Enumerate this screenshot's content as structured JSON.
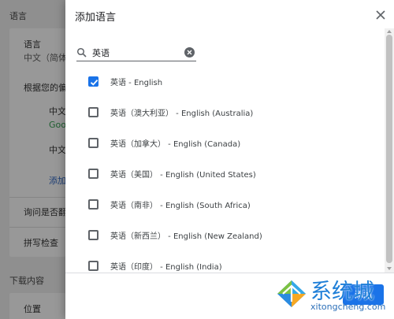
{
  "background": {
    "languages_heading": "语言",
    "language_label": "语言",
    "language_value": "中文（简体",
    "recommendation_text": "根据您的偏",
    "lang_entry_1": "中文",
    "lang_entry_1_sub": "Goo",
    "lang_entry_2": "中文",
    "add_link": "添加",
    "translate_prompt": "询问是否翻",
    "spellcheck_label": "拼写检查",
    "downloads_heading": "下载内容",
    "location_label": "位置"
  },
  "dialog": {
    "title": "添加语言",
    "close_icon": "close-icon",
    "search": {
      "value": "英语",
      "placeholder": ""
    },
    "languages": [
      {
        "label": "英语 - English",
        "checked": true
      },
      {
        "label": "英语（澳大利亚） - English (Australia)",
        "checked": false
      },
      {
        "label": "英语（加拿大） - English (Canada)",
        "checked": false
      },
      {
        "label": "英语（美国） - English (United States)",
        "checked": false
      },
      {
        "label": "英语（南非） - English (South Africa)",
        "checked": false
      },
      {
        "label": "英语（新西兰） - English (New Zealand)",
        "checked": false
      },
      {
        "label": "英语（印度） - English (India)",
        "checked": false
      }
    ],
    "add_button_label": "添加"
  },
  "watermark": {
    "title": "系统城",
    "url": "xitongcheng.com"
  },
  "colors": {
    "accent": "#1a73e8",
    "overlay": "#8f8f8f",
    "watermark_blue": "#1f7fd8"
  }
}
